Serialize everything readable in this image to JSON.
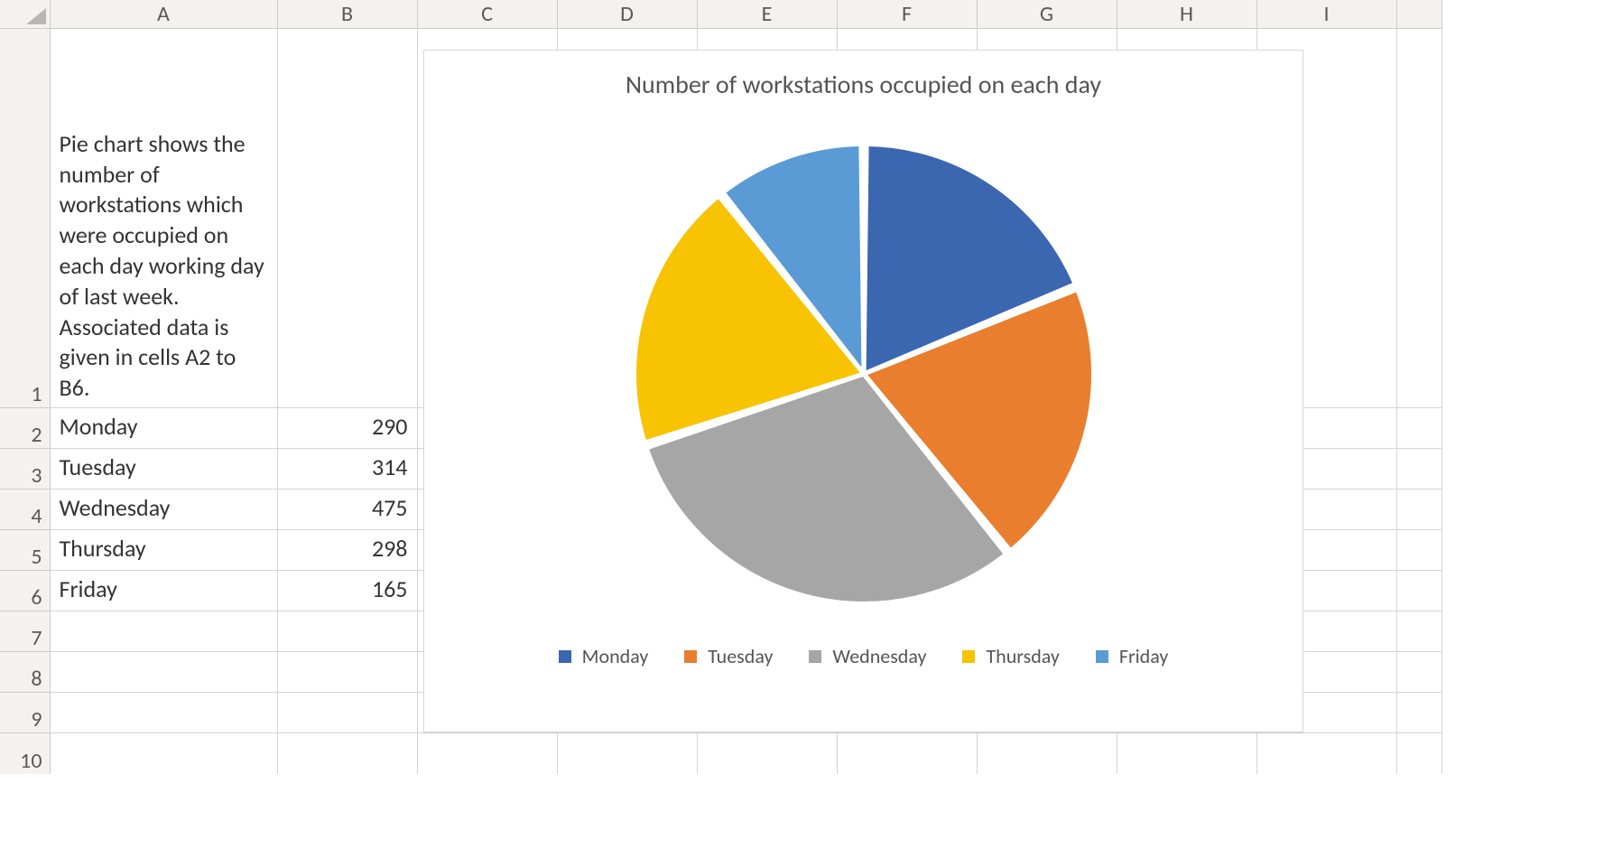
{
  "columns": [
    "A",
    "B",
    "C",
    "D",
    "E",
    "F",
    "G",
    "H",
    "I"
  ],
  "row_numbers": [
    1,
    2,
    3,
    4,
    5,
    6,
    7,
    8,
    9,
    10
  ],
  "cells": {
    "A1": "Pie chart shows the number of workstations which were occupied on each day working day of last week. Associated data is given in cells A2 to B6.",
    "A2": "Monday",
    "B2": "290",
    "A3": "Tuesday",
    "B3": "314",
    "A4": "Wednesday",
    "B4": "475",
    "A5": "Thursday",
    "B5": "298",
    "A6": "Friday",
    "B6": "165"
  },
  "chart_data": {
    "type": "pie",
    "title": "Number of workstations occupied on each day",
    "categories": [
      "Monday",
      "Tuesday",
      "Wednesday",
      "Thursday",
      "Friday"
    ],
    "values": [
      290,
      314,
      475,
      298,
      165
    ],
    "colors": [
      "#3B66B0",
      "#E97E2E",
      "#A6A6A6",
      "#F7C302",
      "#5A9BD5"
    ],
    "legend_position": "bottom"
  }
}
